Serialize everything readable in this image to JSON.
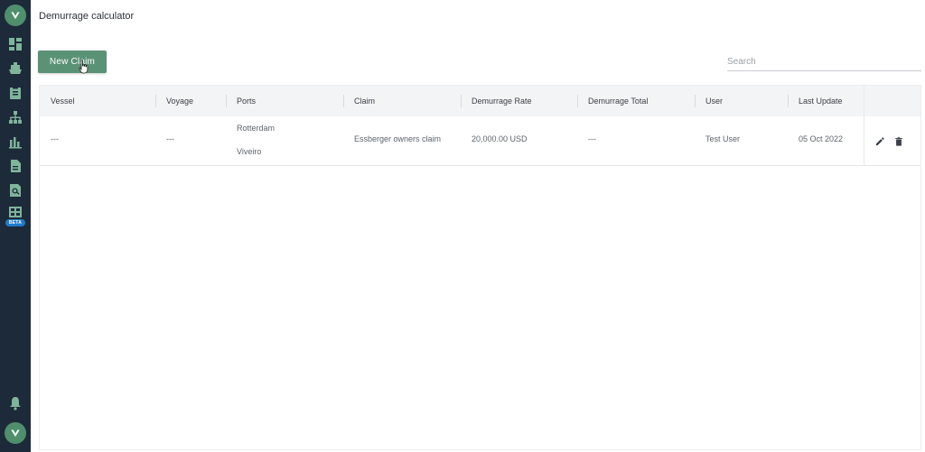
{
  "page": {
    "title": "Demurrage calculator"
  },
  "toolbar": {
    "new_claim_label": "New Claim",
    "search_placeholder": "Search"
  },
  "sidebar": {
    "items": [
      {
        "icon": "logo-icon"
      },
      {
        "icon": "dashboard-icon"
      },
      {
        "icon": "ship-icon"
      },
      {
        "icon": "clipboard-icon"
      },
      {
        "icon": "hierarchy-icon"
      },
      {
        "icon": "bar-chart-icon"
      },
      {
        "icon": "document-icon"
      },
      {
        "icon": "search-document-icon"
      },
      {
        "icon": "calculator-icon",
        "badge": "BETA"
      },
      {
        "icon": "bell-icon"
      },
      {
        "icon": "logo-icon"
      }
    ]
  },
  "table": {
    "columns": [
      "Vessel",
      "Voyage",
      "Ports",
      "Claim",
      "Demurrage Rate",
      "Demurrage Total",
      "User",
      "Last Update"
    ],
    "rows": [
      {
        "vessel": "---",
        "voyage": "---",
        "ports": [
          "Rotterdam",
          "Viveiro"
        ],
        "claim": "Essberger owners claim",
        "demurrage_rate": "20,000.00 USD",
        "demurrage_total": "---",
        "user": "Test User",
        "last_update": "05 Oct 2022"
      }
    ]
  },
  "colors": {
    "sidebar_bg": "#1d2a3a",
    "accent": "#5a9276",
    "sidebar_icon": "#7fb59a",
    "beta_badge": "#1f7acb"
  }
}
